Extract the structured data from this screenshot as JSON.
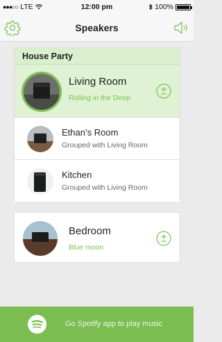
{
  "status_bar": {
    "carrier": "LTE",
    "time": "12:00 pm",
    "battery": "100%"
  },
  "nav": {
    "title": "Speakers"
  },
  "group": {
    "name": "House Party",
    "lead": {
      "room": "Living Room",
      "now_playing": "Rolling in the Deep"
    },
    "members": [
      {
        "room": "Ethan’s Room",
        "status": "Grouped with Living Room"
      },
      {
        "room": "Kitchen",
        "status": "Grouped with Living Room"
      }
    ]
  },
  "single": {
    "room": "Bedroom",
    "now_playing": "Blue moon"
  },
  "spotify": {
    "label": "Go Spotify app to play music"
  },
  "colors": {
    "accent": "#7cc254",
    "group_header_bg": "#d9efce",
    "spotify_bar": "#7cbd52"
  },
  "icons": {
    "settings": "gear-icon",
    "speaker": "speaker-icon",
    "add": "plus-minus-icon",
    "spotify": "spotify-icon"
  }
}
